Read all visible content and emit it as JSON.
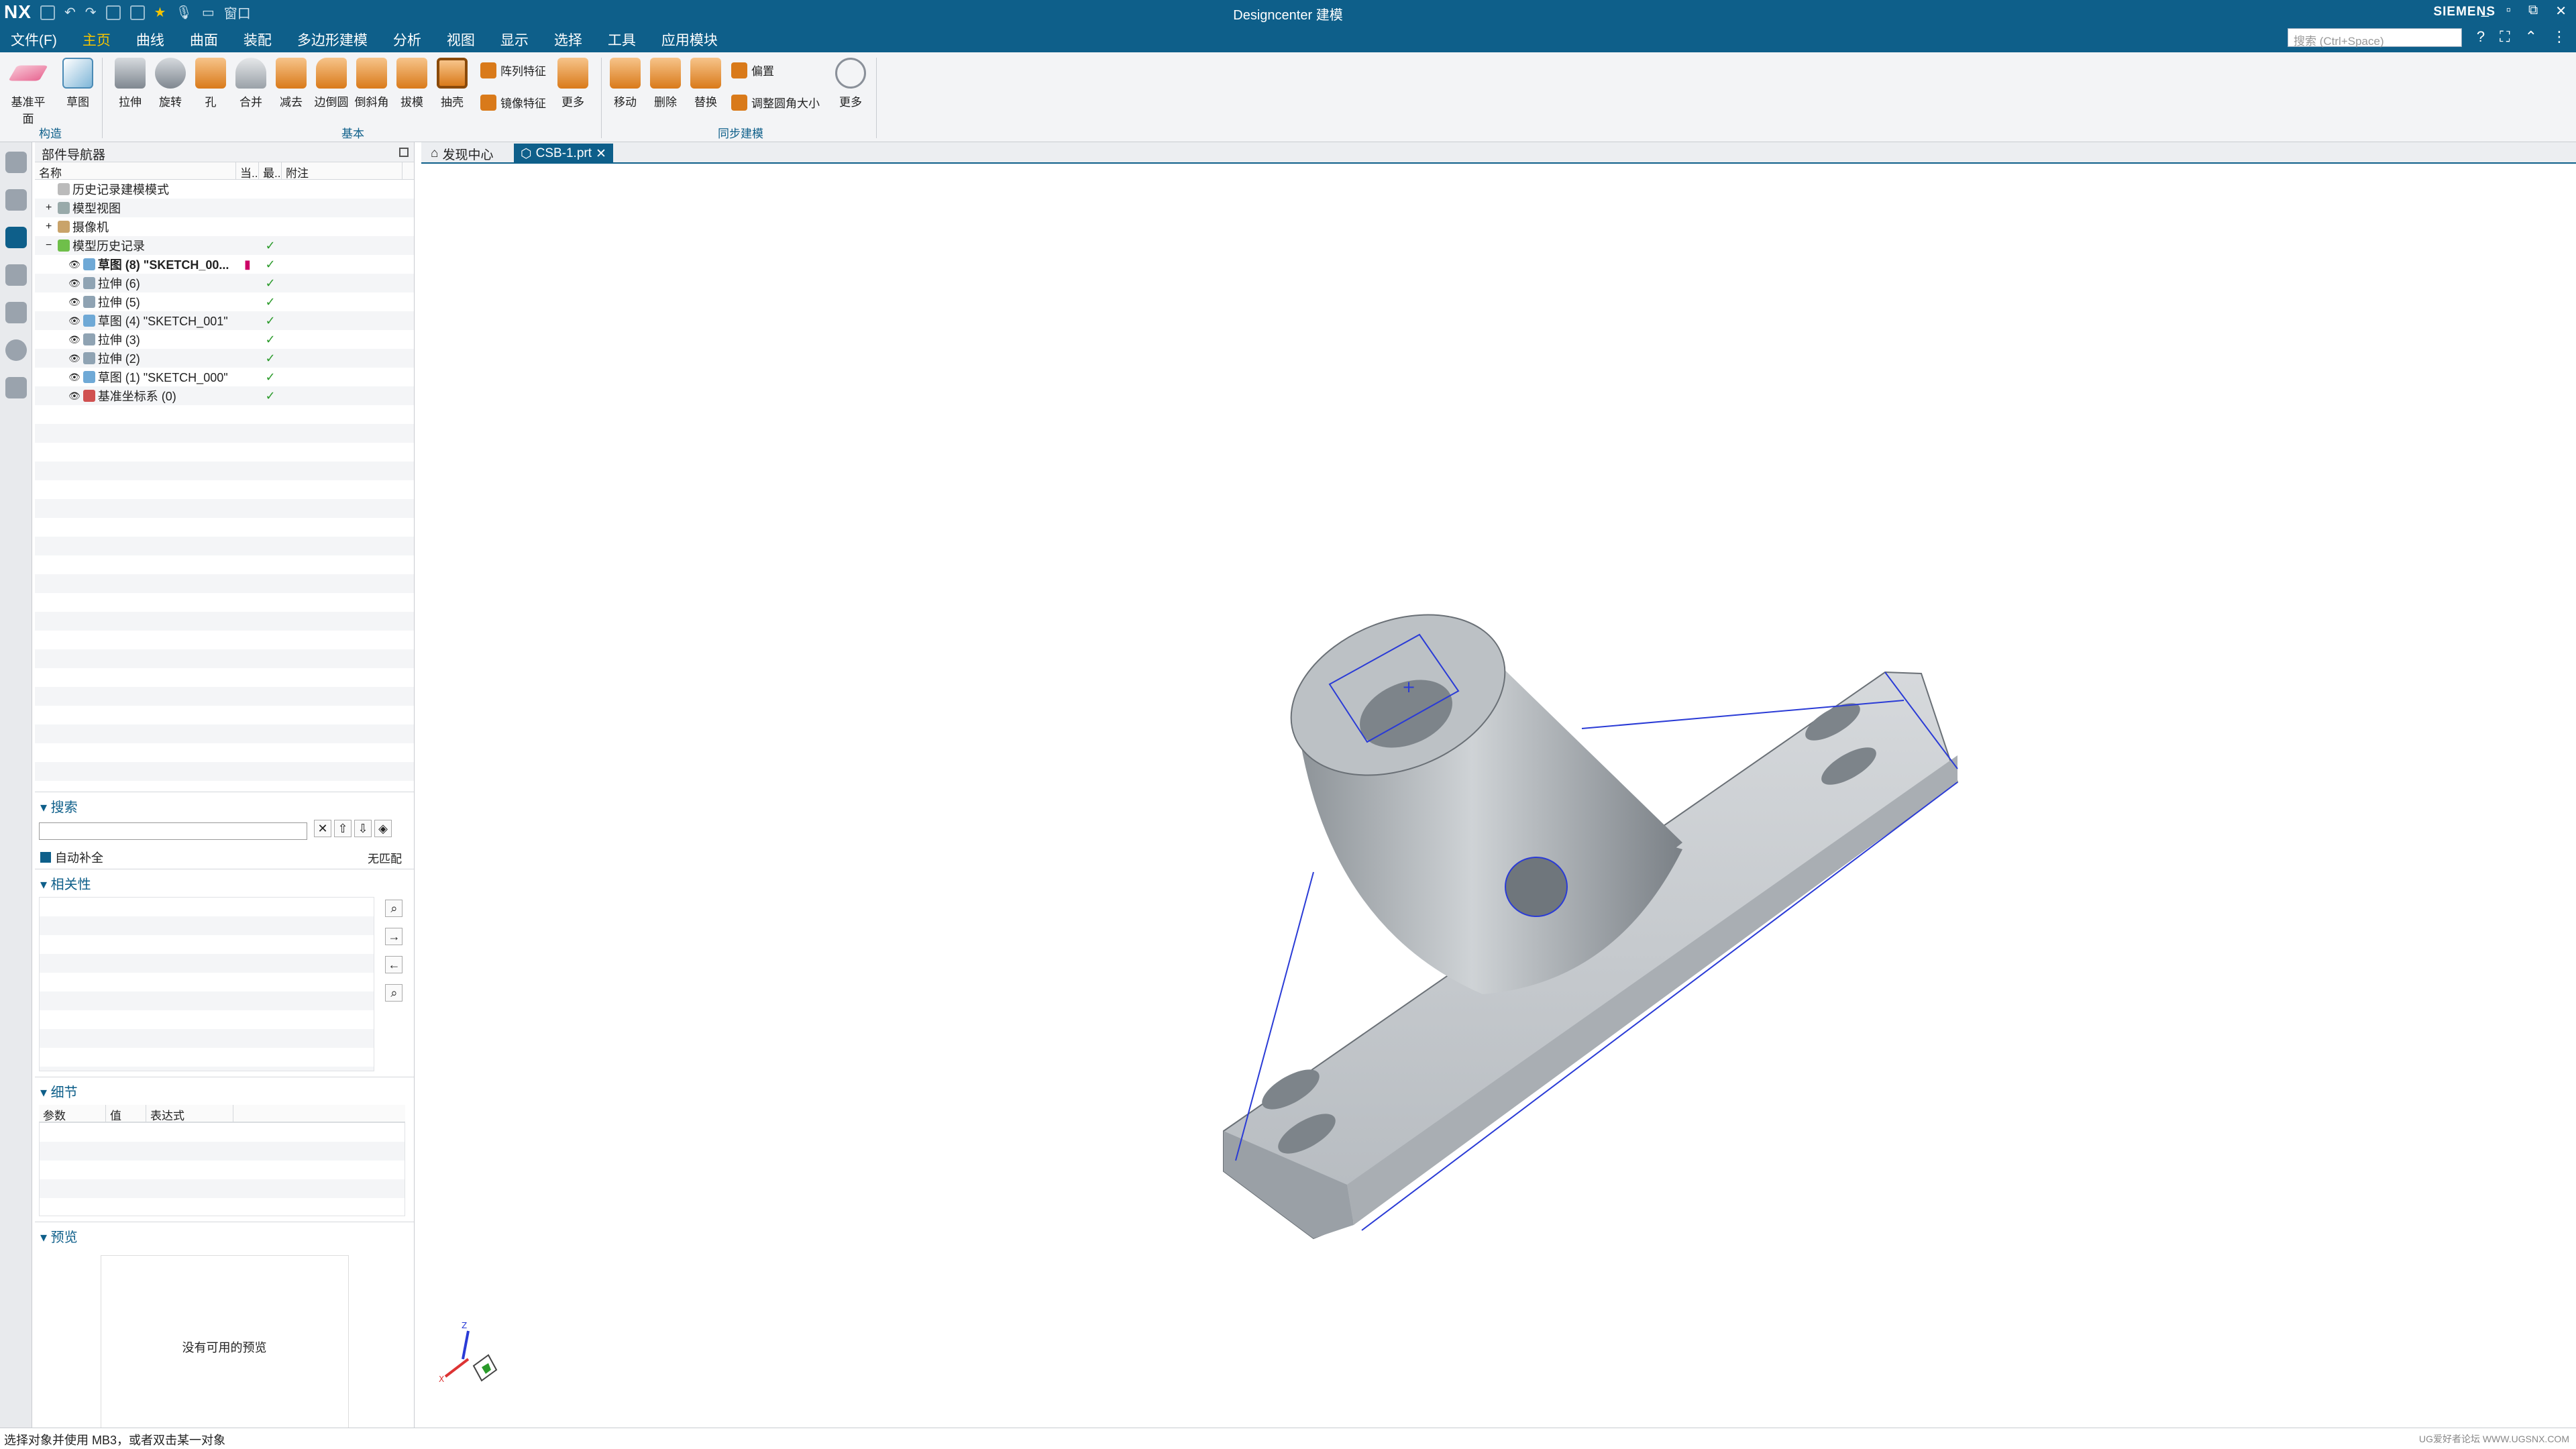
{
  "titlebar": {
    "app": "NX",
    "window_menu": "窗口",
    "title": "Designcenter 建模",
    "brand": "SIEMENS",
    "controls": [
      "_",
      "▫",
      "⧉",
      "✕"
    ]
  },
  "menubar": {
    "items": [
      "文件(F)",
      "主页",
      "曲线",
      "曲面",
      "装配",
      "多边形建模",
      "分析",
      "视图",
      "显示",
      "选择",
      "工具",
      "应用模块"
    ],
    "active": "主页",
    "search_placeholder": "搜索 (Ctrl+Space)"
  },
  "ribbon": {
    "groups": [
      {
        "label": "构造",
        "buttons": [
          "基准平面",
          "草图"
        ]
      },
      {
        "label": "基本",
        "buttons": [
          "拉伸",
          "旋转",
          "孔",
          "合并",
          "减去",
          "边倒圆",
          "倒斜角",
          "拔模",
          "抽壳"
        ],
        "small": [
          "阵列特征",
          "镜像特征"
        ],
        "more": "更多"
      },
      {
        "label": "同步建模",
        "buttons": [
          "移动",
          "删除",
          "替换"
        ],
        "small": [
          "偏置",
          "调整圆角大小"
        ],
        "more": "更多"
      }
    ]
  },
  "navigator": {
    "title": "部件导航器",
    "columns": [
      "名称",
      "当..",
      "最..",
      "附注"
    ],
    "rows": [
      {
        "label": "历史记录建模模式",
        "indent": 1,
        "icon": "clock-icon",
        "status": "",
        "check": ""
      },
      {
        "label": "模型视图",
        "indent": 1,
        "icon": "view-icon",
        "status": "",
        "check": "",
        "expander": "+"
      },
      {
        "label": "摄像机",
        "indent": 1,
        "icon": "camera-icon",
        "status": "",
        "check": "",
        "expander": "+"
      },
      {
        "label": "模型历史记录",
        "indent": 1,
        "icon": "history-icon",
        "status": "",
        "check": "✓",
        "expander": "−"
      },
      {
        "label": "草图 (8) \"SKETCH_00...",
        "indent": 2,
        "icon": "sketch-icon",
        "status": "▮",
        "check": "✓",
        "bold": true
      },
      {
        "label": "拉伸 (6)",
        "indent": 2,
        "icon": "extrude-icon",
        "status": "",
        "check": "✓"
      },
      {
        "label": "拉伸 (5)",
        "indent": 2,
        "icon": "extrude-icon",
        "status": "",
        "check": "✓"
      },
      {
        "label": "草图 (4) \"SKETCH_001\"",
        "indent": 2,
        "icon": "sketch-icon",
        "status": "",
        "check": "✓"
      },
      {
        "label": "拉伸 (3)",
        "indent": 2,
        "icon": "extrude-icon",
        "status": "",
        "check": "✓"
      },
      {
        "label": "拉伸 (2)",
        "indent": 2,
        "icon": "extrude-icon",
        "status": "",
        "check": "✓"
      },
      {
        "label": "草图 (1) \"SKETCH_000\"",
        "indent": 2,
        "icon": "sketch-icon",
        "status": "",
        "check": "✓"
      },
      {
        "label": "基准坐标系 (0)",
        "indent": 2,
        "icon": "datum-csys-icon",
        "status": "",
        "check": "✓"
      }
    ],
    "search": {
      "title": "搜索",
      "auto_complete": "自动补全",
      "match": "无匹配"
    },
    "relevance": {
      "title": "相关性"
    },
    "details": {
      "title": "细节",
      "columns": [
        "参数",
        "值",
        "表达式"
      ]
    },
    "preview": {
      "title": "预览",
      "empty": "没有可用的预览"
    }
  },
  "tabs": [
    {
      "label": "发现中心",
      "active": false
    },
    {
      "label": "CSB-1.prt",
      "active": true
    }
  ],
  "status": {
    "message": "选择对象并使用 MB3，或者双击某一对象",
    "watermark": "UG爱好者论坛 WWW.UGSNX.COM"
  },
  "colors": {
    "brand": "#0e5f8a",
    "accent": "#f5c400",
    "part": "#b9bec3",
    "edge": "#2a3bd6"
  }
}
